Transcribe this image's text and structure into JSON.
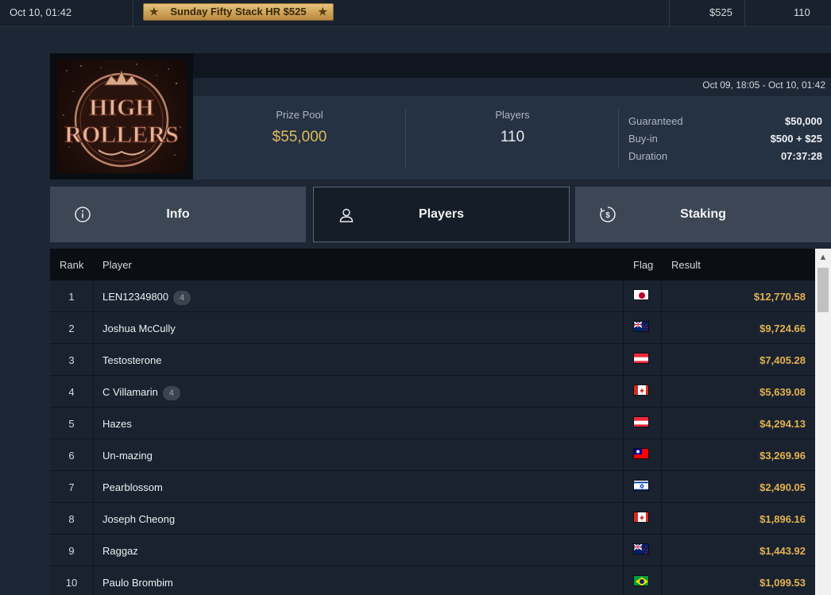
{
  "top_row": {
    "datetime": "Oct 10, 01:42",
    "tournament_name": "Sunday Fifty Stack HR $525",
    "buyin": "$525",
    "entries": "110"
  },
  "header": {
    "logo_text": "HIGH ROLLERS",
    "dates": "Oct 09, 18:05 - Oct 10, 01:42",
    "prize_pool_label": "Prize Pool",
    "prize_pool_value": "$55,000",
    "players_label": "Players",
    "players_value": "110",
    "details": [
      {
        "label": "Guaranteed",
        "value": "$50,000"
      },
      {
        "label": "Buy-in",
        "value": "$500 + $25"
      },
      {
        "label": "Duration",
        "value": "07:37:28"
      }
    ]
  },
  "tabs": [
    {
      "label": "Info",
      "icon": "info-icon",
      "active": false
    },
    {
      "label": "Players",
      "icon": "user-icon",
      "active": true
    },
    {
      "label": "Staking",
      "icon": "dollar-coin-icon",
      "active": false
    }
  ],
  "table": {
    "columns": {
      "rank": "Rank",
      "player": "Player",
      "flag": "Flag",
      "result": "Result"
    },
    "rows": [
      {
        "rank": "1",
        "player": "LEN12349800",
        "count": "4",
        "flag": "japan",
        "result": "$12,770.58"
      },
      {
        "rank": "2",
        "player": "Joshua McCully",
        "count": "",
        "flag": "new-zealand",
        "result": "$9,724.66"
      },
      {
        "rank": "3",
        "player": "Testosterone",
        "count": "",
        "flag": "austria",
        "result": "$7,405.28"
      },
      {
        "rank": "4",
        "player": "C Villamarin",
        "count": "4",
        "flag": "canada",
        "result": "$5,639.08"
      },
      {
        "rank": "5",
        "player": "Hazes",
        "count": "",
        "flag": "austria",
        "result": "$4,294.13"
      },
      {
        "rank": "6",
        "player": "Un-mazing",
        "count": "",
        "flag": "taiwan",
        "result": "$3,269.96"
      },
      {
        "rank": "7",
        "player": "Pearblossom",
        "count": "",
        "flag": "israel",
        "result": "$2,490.05"
      },
      {
        "rank": "8",
        "player": "Joseph Cheong",
        "count": "",
        "flag": "canada",
        "result": "$1,896.16"
      },
      {
        "rank": "9",
        "player": "Raggaz",
        "count": "",
        "flag": "new-zealand",
        "result": "$1,443.92"
      },
      {
        "rank": "10",
        "player": "Paulo Brombim",
        "count": "",
        "flag": "brazil",
        "result": "$1,099.53"
      }
    ]
  },
  "colors": {
    "gold": "#e2b24e",
    "panel": "#253243",
    "row": "#1a2230"
  }
}
